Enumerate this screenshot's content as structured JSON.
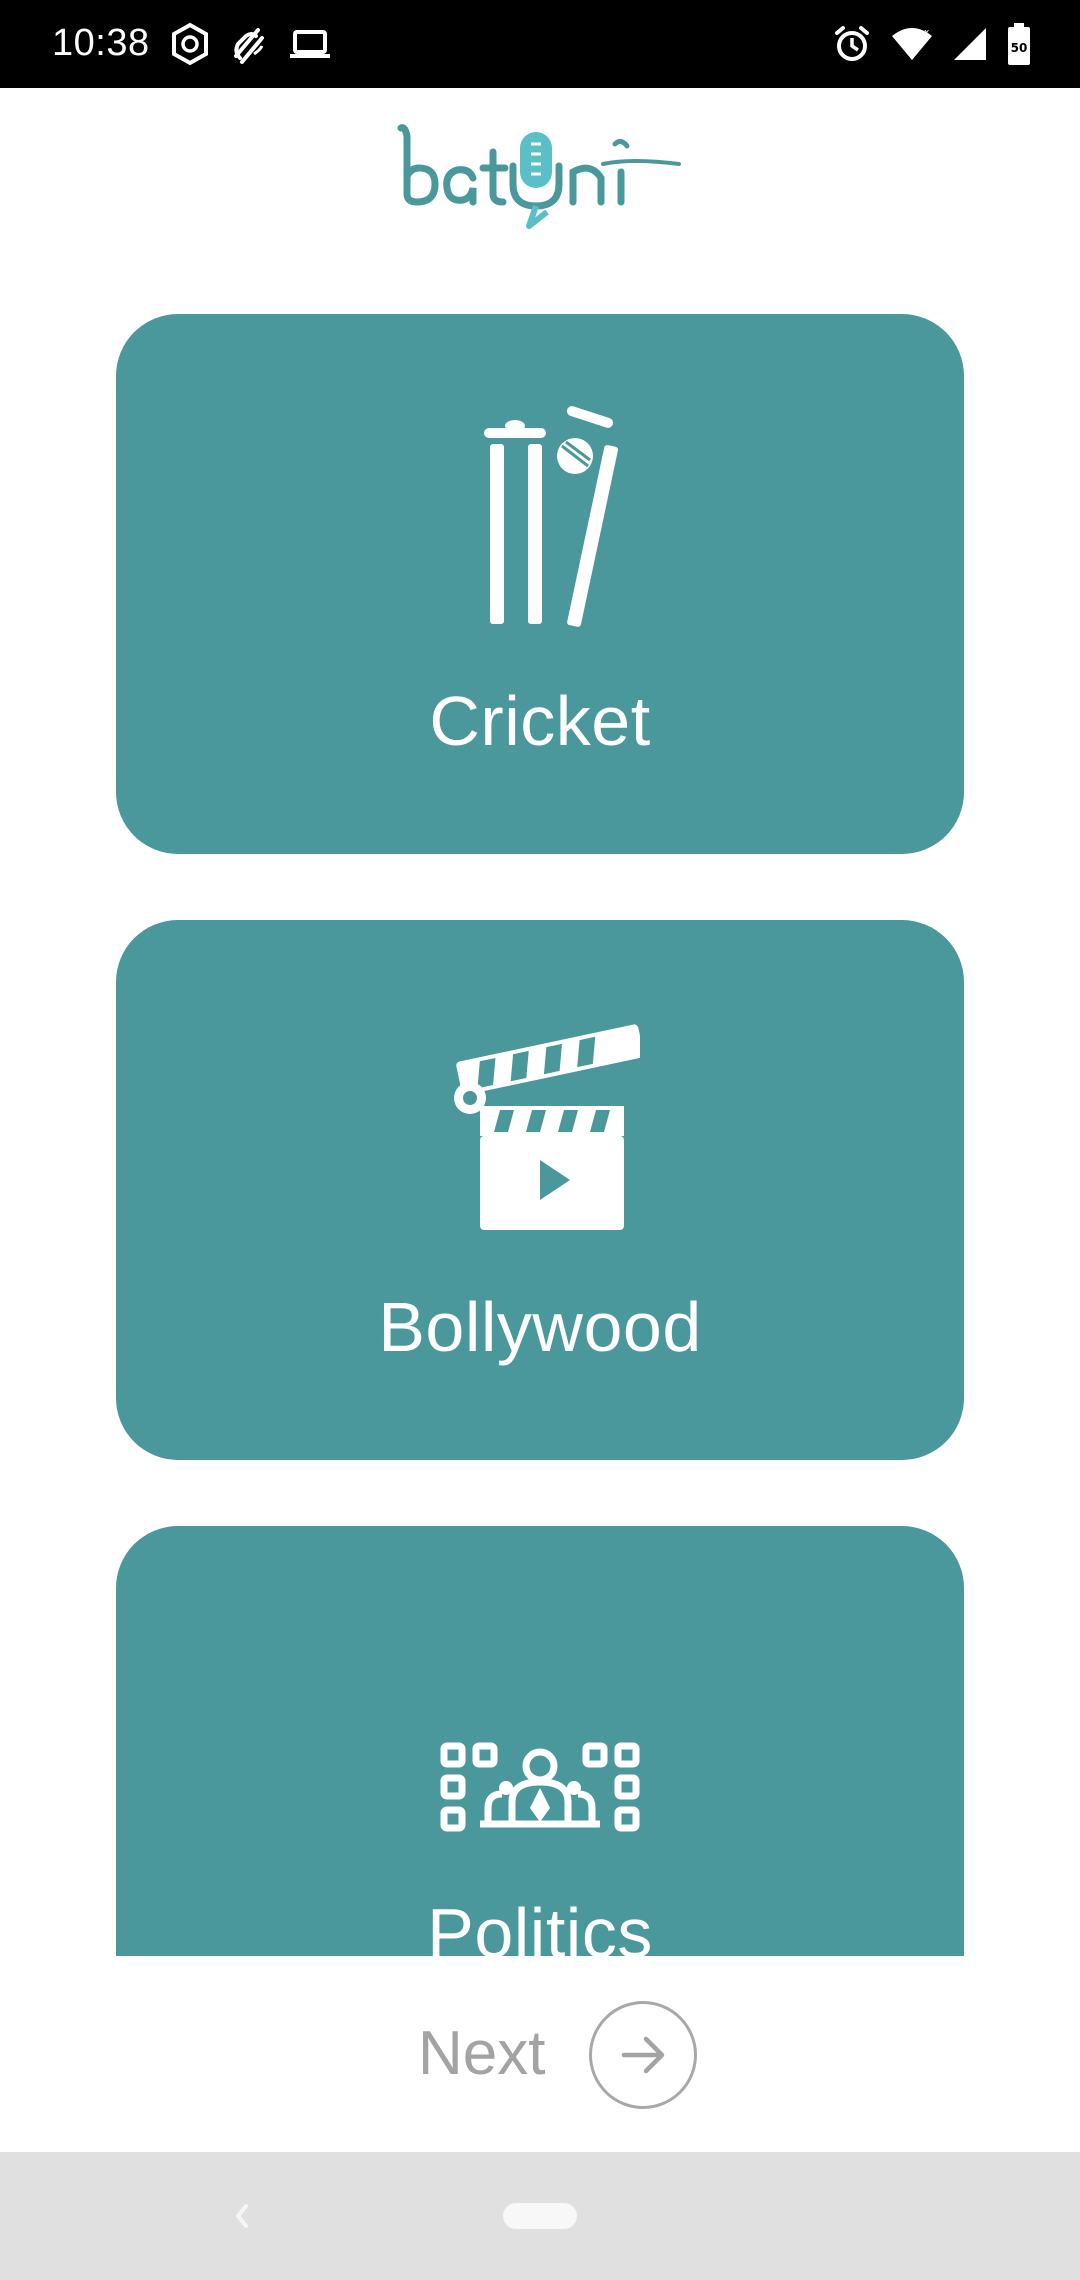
{
  "status_bar": {
    "time": "10:38",
    "icons_left": [
      "settings-hex-icon",
      "mute-icon",
      "laptop-icon"
    ],
    "icons_right": [
      "alarm-icon",
      "wifi-icon",
      "signal-icon",
      "battery-icon"
    ],
    "battery_level": "50"
  },
  "app": {
    "logo_text": "batuni",
    "brand_color": "#4a989c",
    "logo_accent": "#5bbfc8"
  },
  "categories": [
    {
      "label": "Cricket",
      "icon": "cricket-wickets-icon"
    },
    {
      "label": "Bollywood",
      "icon": "clapperboard-icon"
    },
    {
      "label": "Politics",
      "icon": "parliament-icon"
    }
  ],
  "footer": {
    "next_label": "Next",
    "next_icon": "arrow-right-icon"
  },
  "nav_bar": {
    "back_icon": "back-chevron-icon",
    "home_icon": "home-pill-icon"
  }
}
